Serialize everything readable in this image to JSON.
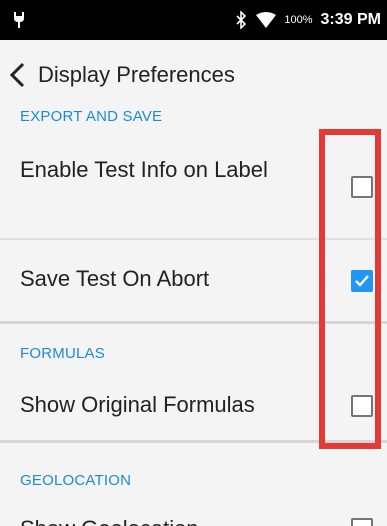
{
  "status_bar": {
    "battery": "100%",
    "time": "3:39 PM",
    "left_icon": "android-debug-icon",
    "bluetooth_icon": "bluetooth-icon",
    "wifi_icon": "wifi-icon"
  },
  "app_bar": {
    "back_icon": "chevron-left-icon",
    "title": "Display Preferences"
  },
  "sections": [
    {
      "header": "EXPORT AND SAVE",
      "items": [
        {
          "label": "Enable Test Info on Label",
          "checked": false
        },
        {
          "label": "Save Test On Abort",
          "checked": true
        }
      ]
    },
    {
      "header": "FORMULAS",
      "items": [
        {
          "label": "Show Original Formulas",
          "checked": false
        }
      ]
    },
    {
      "header": "GEOLOCATION",
      "items": [
        {
          "label": "Show Geolocation",
          "checked": false
        }
      ]
    }
  ],
  "colors": {
    "accent": "#1b8bd4",
    "checkbox_checked": "#2196f3",
    "highlight": "#e53935",
    "status_bar": "#000000"
  }
}
